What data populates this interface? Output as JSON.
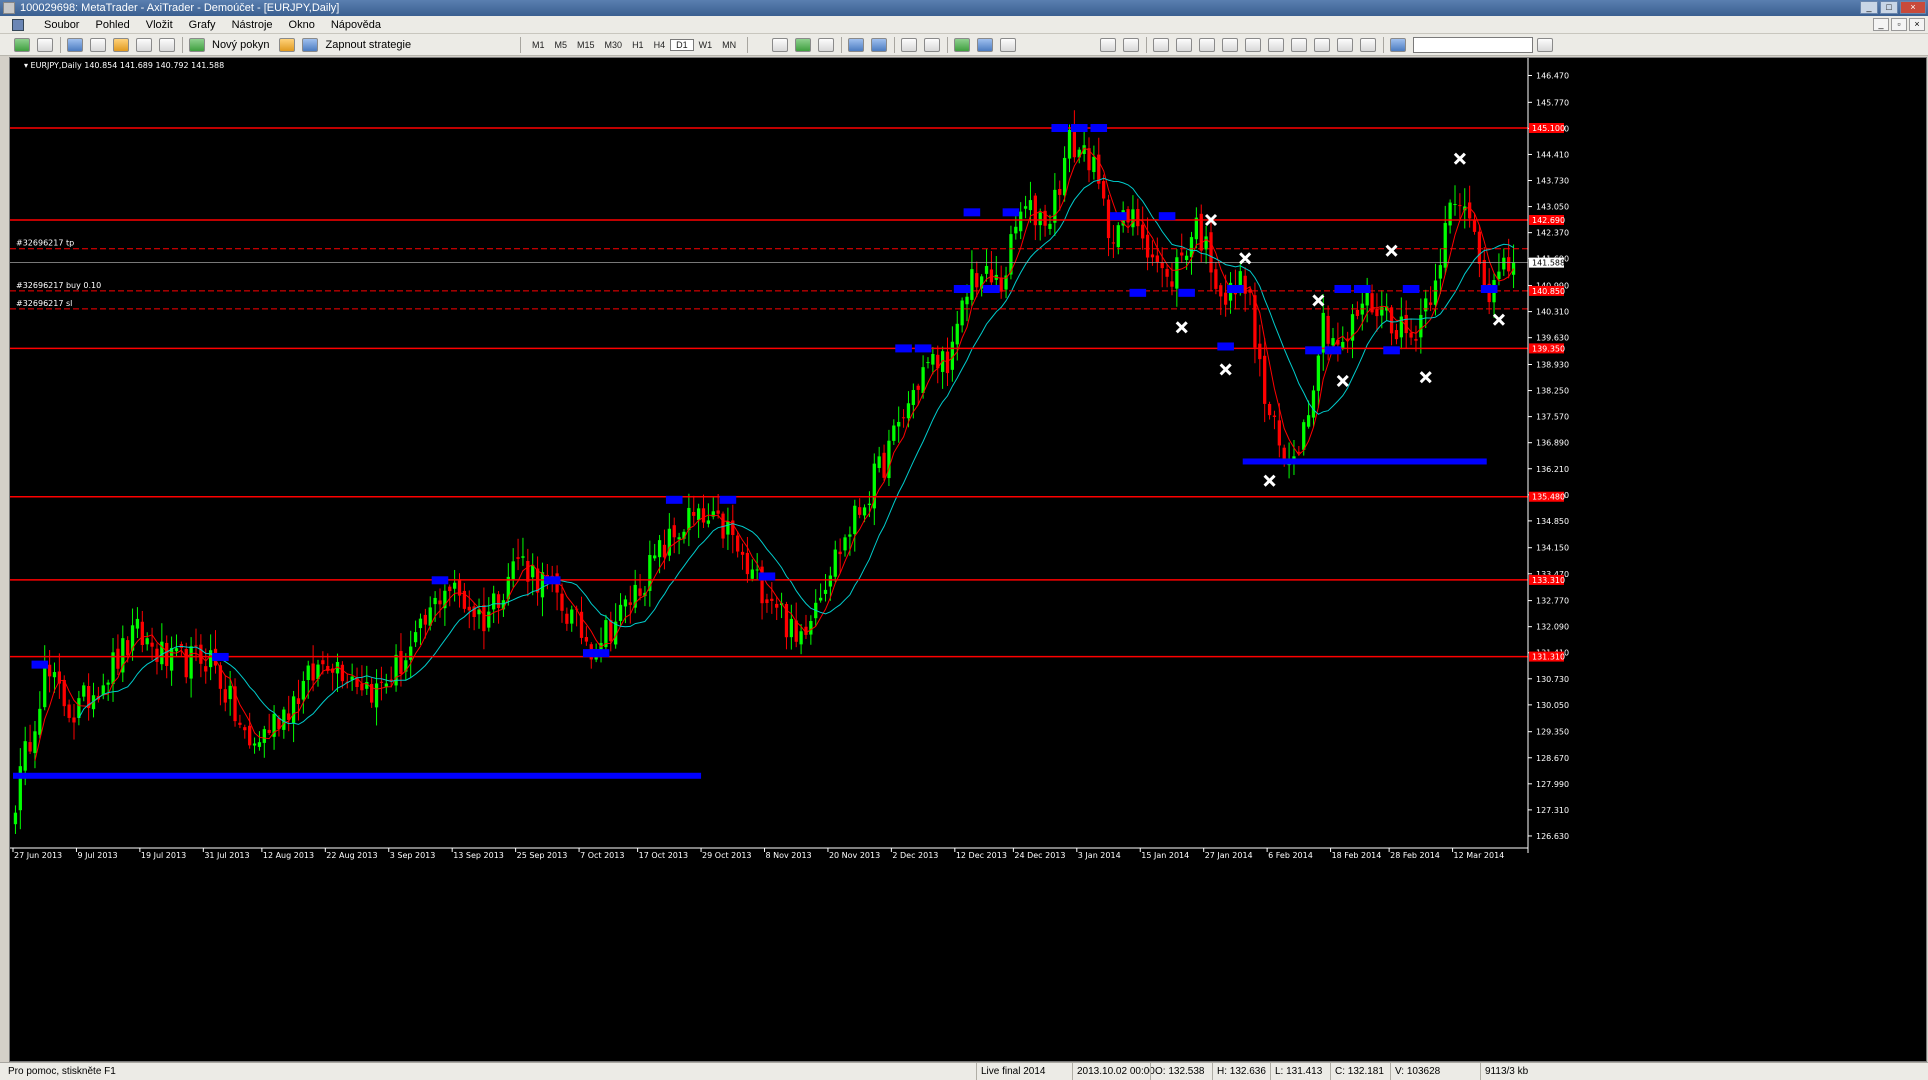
{
  "window": {
    "title": "100029698: MetaTrader - AxiTrader - Demoúčet - [EURJPY,Daily]",
    "min": "_",
    "max": "□",
    "close": "×"
  },
  "menu": [
    "Soubor",
    "Pohled",
    "Vložit",
    "Grafy",
    "Nástroje",
    "Okno",
    "Nápověda"
  ],
  "toolbar": {
    "new_order": "Nový pokyn",
    "strategy": "Zapnout strategie",
    "timeframes": [
      "M1",
      "M5",
      "M15",
      "M30",
      "H1",
      "H4",
      "D1",
      "W1",
      "MN"
    ],
    "active_timeframe": "D1"
  },
  "colors": {
    "bull": "#00ff00",
    "bear": "#ff0000",
    "level": "#ff0000",
    "zone": "#0000ff",
    "ma_fast": "#ff0000",
    "ma_slow": "#00cccc",
    "axis_bg": "#000000",
    "axis_text": "#ffffff"
  },
  "chart_data": {
    "type": "candlestick",
    "symbol_label": "EURJPY,Daily",
    "ohlc_readout": "140.854 141.689 140.792 141.588",
    "ylim": [
      126.42,
      146.77
    ],
    "price_ticks": [
      "146.470",
      "145.770",
      "145.090",
      "144.410",
      "143.730",
      "143.050",
      "142.370",
      "141.690",
      "140.990",
      "140.310",
      "139.630",
      "138.930",
      "138.250",
      "137.570",
      "136.890",
      "136.210",
      "135.530",
      "134.850",
      "134.150",
      "133.470",
      "132.770",
      "132.090",
      "131.410",
      "130.730",
      "130.050",
      "129.350",
      "128.670",
      "127.990",
      "127.310",
      "126.630"
    ],
    "current_price": "141.588",
    "date_labels": [
      "27 Jun 2013",
      "9 Jul 2013",
      "19 Jul 2013",
      "31 Jul 2013",
      "12 Aug 2013",
      "22 Aug 2013",
      "3 Sep 2013",
      "13 Sep 2013",
      "25 Sep 2013",
      "7 Oct 2013",
      "17 Oct 2013",
      "29 Oct 2013",
      "8 Nov 2013",
      "20 Nov 2013",
      "2 Dec 2013",
      "12 Dec 2013",
      "24 Dec 2013",
      "3 Jan 2014",
      "15 Jan 2014",
      "27 Jan 2014",
      "6 Feb 2014",
      "18 Feb 2014",
      "28 Feb 2014",
      "12 Mar 2014"
    ],
    "levels": [
      {
        "price": 145.1,
        "label": "145.100"
      },
      {
        "price": 142.7,
        "label": "142.690"
      },
      {
        "price": 139.35,
        "label": "139.350"
      },
      {
        "price": 135.48,
        "label": "135.480"
      },
      {
        "price": 133.31,
        "label": "133.310"
      },
      {
        "price": 131.31,
        "label": "131.310"
      }
    ],
    "orders": [
      {
        "price": 141.95,
        "label": "#32696217 tp"
      },
      {
        "price": 140.85,
        "label": "#32696217 buy 0.10",
        "price_label": "140.850"
      },
      {
        "price": 140.38,
        "label": "#32696217 sl"
      }
    ],
    "support_bars": [
      {
        "price": 128.2,
        "from": 0,
        "to": 141
      },
      {
        "price": 136.4,
        "from": 252,
        "to": 302
      }
    ],
    "zones": [
      {
        "i": 5,
        "p": 131.1
      },
      {
        "i": 42,
        "p": 131.3
      },
      {
        "i": 87,
        "p": 133.3
      },
      {
        "i": 110,
        "p": 133.3
      },
      {
        "i": 118,
        "p": 131.4
      },
      {
        "i": 120,
        "p": 131.4
      },
      {
        "i": 135,
        "p": 135.4
      },
      {
        "i": 146,
        "p": 135.4
      },
      {
        "i": 154,
        "p": 133.4
      },
      {
        "i": 182,
        "p": 139.35
      },
      {
        "i": 186,
        "p": 139.35
      },
      {
        "i": 194,
        "p": 140.9
      },
      {
        "i": 196,
        "p": 142.9
      },
      {
        "i": 200,
        "p": 140.9
      },
      {
        "i": 204,
        "p": 142.9
      },
      {
        "i": 214,
        "p": 145.1
      },
      {
        "i": 218,
        "p": 145.1
      },
      {
        "i": 222,
        "p": 145.1
      },
      {
        "i": 226,
        "p": 142.8
      },
      {
        "i": 230,
        "p": 140.8
      },
      {
        "i": 236,
        "p": 142.8
      },
      {
        "i": 240,
        "p": 140.8
      },
      {
        "i": 248,
        "p": 139.4
      },
      {
        "i": 250,
        "p": 140.9
      },
      {
        "i": 266,
        "p": 139.3
      },
      {
        "i": 270,
        "p": 139.3
      },
      {
        "i": 272,
        "p": 140.9
      },
      {
        "i": 276,
        "p": 140.9
      },
      {
        "i": 282,
        "p": 139.3
      },
      {
        "i": 286,
        "p": 140.9
      },
      {
        "i": 302,
        "p": 140.9
      }
    ],
    "swing_marks": [
      {
        "i": 239,
        "p": 139.9
      },
      {
        "i": 245,
        "p": 142.7
      },
      {
        "i": 248,
        "p": 138.8
      },
      {
        "i": 252,
        "p": 141.7
      },
      {
        "i": 257,
        "p": 135.9
      },
      {
        "i": 267,
        "p": 140.6
      },
      {
        "i": 272,
        "p": 138.5
      },
      {
        "i": 282,
        "p": 141.9
      },
      {
        "i": 289,
        "p": 138.6
      },
      {
        "i": 296,
        "p": 144.3
      },
      {
        "i": 304,
        "p": 140.1
      }
    ]
  },
  "status": {
    "help": "Pro pomoc, stiskněte F1",
    "profile": "Live final 2014",
    "time": "2013.10.02 00:00",
    "open": "O: 132.538",
    "high": "H: 132.636",
    "low": "L: 131.413",
    "close": "C: 132.181",
    "volume": "V: 103628",
    "traffic": "9113/3 kb"
  }
}
